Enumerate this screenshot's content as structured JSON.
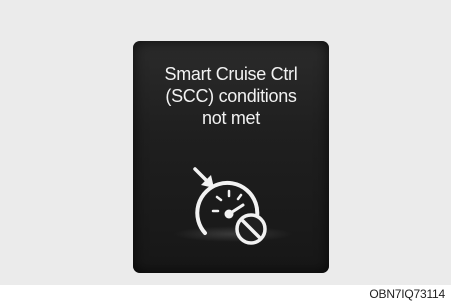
{
  "display": {
    "message_lines": [
      "Smart Cruise Ctrl",
      "(SCC) conditions",
      "not met"
    ],
    "icon": "cruise-control-disabled-icon"
  },
  "caption": {
    "code": "OBN7IQ73114"
  },
  "colors": {
    "panel_background": "#ebebeb",
    "display_background": "#1f1f1f",
    "text": "#f2f2f2"
  }
}
